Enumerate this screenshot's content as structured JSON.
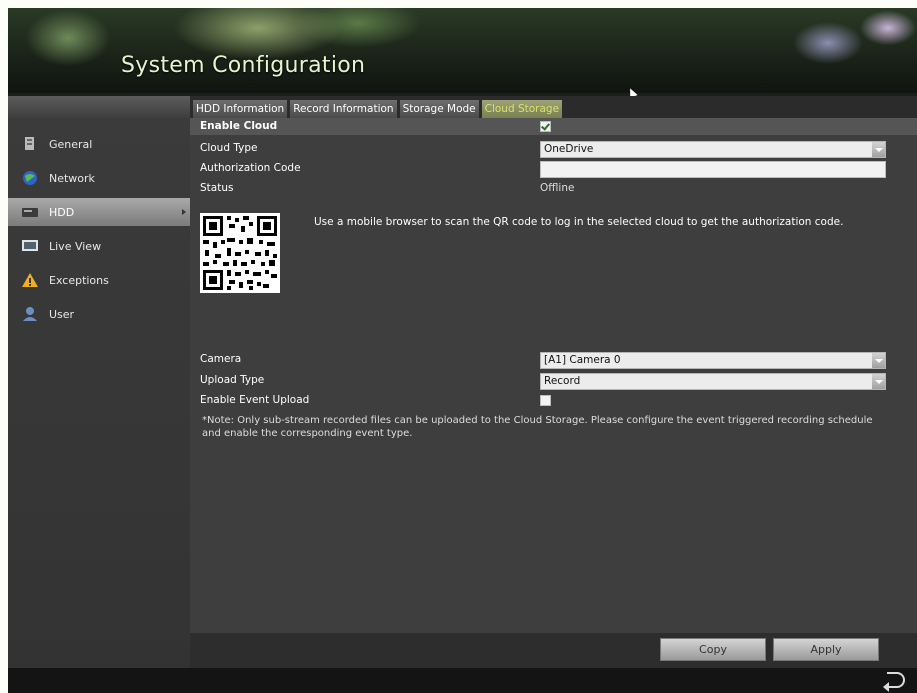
{
  "window": {
    "title": "System Configuration"
  },
  "sidebar": {
    "items": [
      {
        "label": "General",
        "icon": "general-icon"
      },
      {
        "label": "Network",
        "icon": "network-icon"
      },
      {
        "label": "HDD",
        "icon": "hdd-icon",
        "active": true
      },
      {
        "label": "Live View",
        "icon": "monitor-icon"
      },
      {
        "label": "Exceptions",
        "icon": "warning-icon"
      },
      {
        "label": "User",
        "icon": "user-icon"
      }
    ]
  },
  "tabs": [
    {
      "label": "HDD Information"
    },
    {
      "label": "Record Information"
    },
    {
      "label": "Storage Mode"
    },
    {
      "label": "Cloud Storage",
      "active": true
    }
  ],
  "form": {
    "enable_cloud": {
      "label": "Enable Cloud",
      "checked": true
    },
    "cloud_type": {
      "label": "Cloud Type",
      "value": "OneDrive"
    },
    "authorization_code": {
      "label": "Authorization Code",
      "value": ""
    },
    "status": {
      "label": "Status",
      "value": "Offline"
    },
    "qr_hint": "Use a mobile browser to scan the QR code to log in the selected cloud to get the authorization code.",
    "camera": {
      "label": "Camera",
      "value": "[A1] Camera 0"
    },
    "upload_type": {
      "label": "Upload Type",
      "value": "Record"
    },
    "enable_event_upload": {
      "label": "Enable Event Upload",
      "checked": false
    },
    "note": "*Note: Only sub-stream recorded files can be uploaded to the Cloud Storage. Please configure the event triggered recording schedule and enable the corresponding event type."
  },
  "buttons": {
    "copy": "Copy",
    "apply": "Apply"
  },
  "colors": {
    "accent_tab_text": "#d8e36a",
    "panel_bg": "#3e3e3e"
  }
}
